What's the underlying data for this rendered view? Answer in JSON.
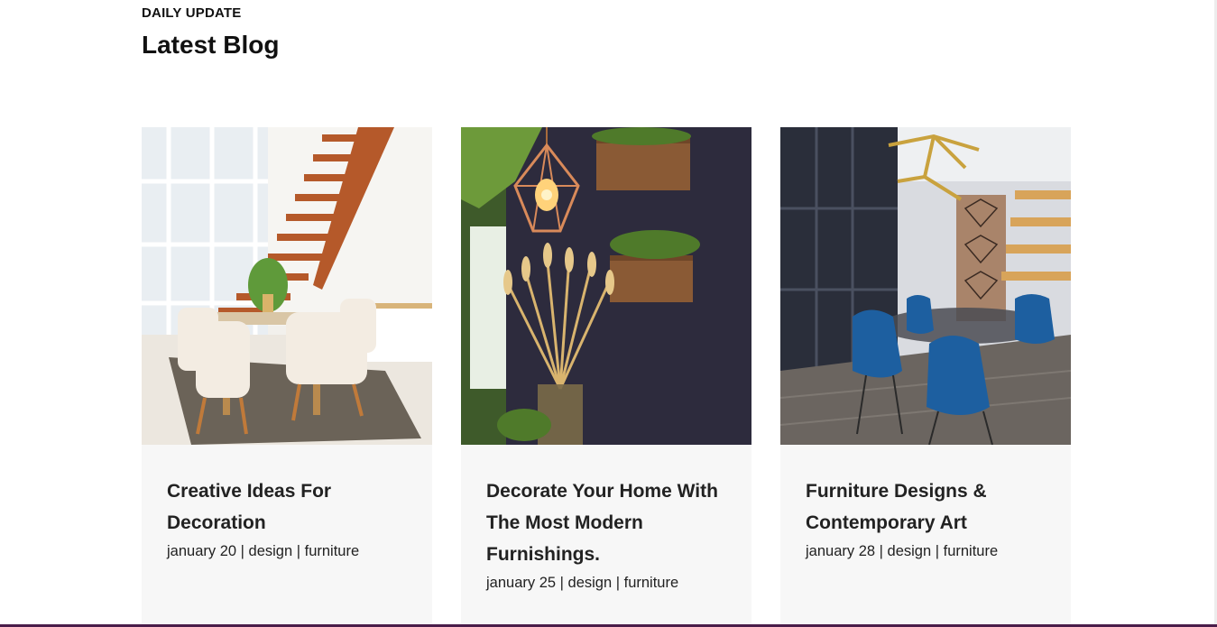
{
  "section": {
    "eyebrow": "DAILY UPDATE",
    "title": "Latest Blog"
  },
  "posts": [
    {
      "title": "Creative Ideas For Decoration",
      "date": "january 20",
      "category": "design",
      "tag": "furniture",
      "image_icon": "dining-room-staircase-photo"
    },
    {
      "title": "Decorate Your Home With The Most Modern Furnishings.",
      "date": "january 25",
      "category": "design",
      "tag": "furniture",
      "image_icon": "pendant-lamp-wheat-decor-photo"
    },
    {
      "title": "Furniture Designs & Contemporary Art",
      "date": "january 28",
      "category": "design",
      "tag": "furniture",
      "image_icon": "blue-chairs-dining-photo"
    }
  ],
  "separator": " | ",
  "colors": {
    "card_background": "#f7f7f7",
    "text": "#222222",
    "bottom_bar": "#4a1d4a"
  }
}
